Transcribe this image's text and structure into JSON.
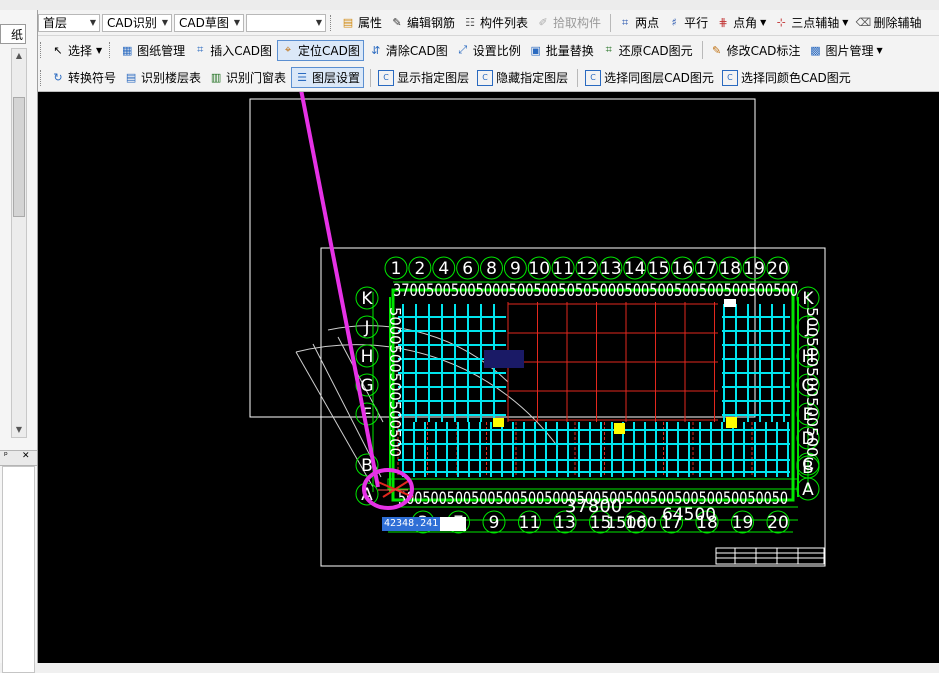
{
  "toolbar_row1": {
    "floor_combo": "首层",
    "mode_combo": "CAD识别",
    "type_combo": "CAD草图",
    "blank_combo": "",
    "buttons": [
      "属性",
      "编辑钢筋",
      "构件列表",
      "拾取构件",
      "两点",
      "平行",
      "点角",
      "三点辅轴",
      "删除辅轴"
    ]
  },
  "toolbar_row2": {
    "select_label": "选择",
    "buttons": [
      "图纸管理",
      "插入CAD图",
      "定位CAD图",
      "清除CAD图",
      "设置比例",
      "批量替换",
      "还原CAD图元",
      "修改CAD标注",
      "图片管理"
    ]
  },
  "toolbar_row3": {
    "buttons": [
      "转换符号",
      "识别楼层表",
      "识别门窗表",
      "图层设置",
      "显示指定图层",
      "隐藏指定图层",
      "选择同图层CAD图元",
      "选择同颜色CAD图元"
    ]
  },
  "left_panel": {
    "tab_label": "纸",
    "panel_pin": "ᵖ",
    "panel_close": "✕"
  },
  "drawing": {
    "top_axis_labels": [
      "1",
      "2",
      "4",
      "6",
      "8",
      "9",
      "10",
      "11",
      "12",
      "13",
      "14",
      "15",
      "16",
      "17",
      "18",
      "19",
      "20"
    ],
    "bottom_axis_labels": [
      "3",
      "7",
      "9",
      "11",
      "13",
      "15",
      "16",
      "17",
      "18",
      "19",
      "20"
    ],
    "left_axis_labels": [
      "K",
      "J",
      "H",
      "G",
      "F",
      "B",
      "A"
    ],
    "right_axis_labels": [
      "K",
      "J",
      "H",
      "G",
      "E",
      "D",
      "C",
      "B",
      "A"
    ],
    "dim_text_top": "3700500500500050050050505000500500500500500500500",
    "dim_text_bottom": "500500500500500500500050050050050050050050050050",
    "dim_text_left": "5000500500500500",
    "dim_text_right": "500500500500500",
    "overall_dim": "37800",
    "right_dim": "64500",
    "overlap_text": "15000",
    "coordinate_readout": "42348.241"
  },
  "colors": {
    "canvas_bg": "#000000",
    "cad_white": "#ffffff",
    "cad_green": "#00e600",
    "cad_cyan": "#00e5ee",
    "cad_red": "#e2281e",
    "cad_yellow": "#ffff00",
    "annotation_magenta": "#e632e6",
    "selection_blue": "#2f6fd6"
  }
}
